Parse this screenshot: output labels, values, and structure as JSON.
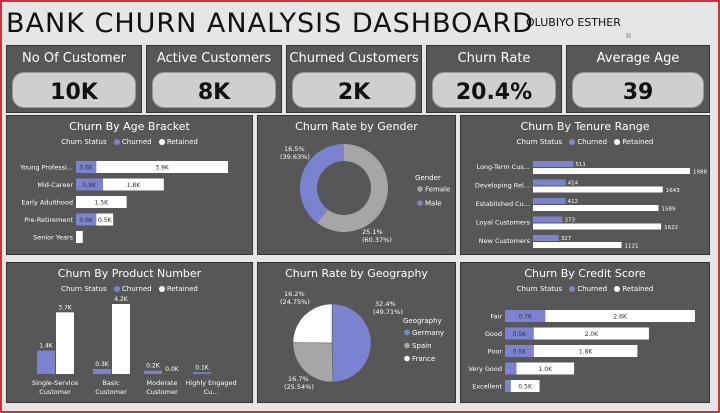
{
  "header": {
    "title": "BANK CHURN ANALYSIS DASHBOARD",
    "author": "OLUBIYO ESTHER"
  },
  "kpis": [
    {
      "label": "No Of Customer",
      "value": "10K"
    },
    {
      "label": "Active Customers",
      "value": "8K"
    },
    {
      "label": "Churned Customers",
      "value": "2K"
    },
    {
      "label": "Churn Rate",
      "value": "20.4%"
    },
    {
      "label": "Average Age",
      "value": "39"
    }
  ],
  "colors": {
    "churned": "#7b83d0",
    "retained": "#ffffff",
    "panel": "#575757",
    "spain": "#a6a6a6"
  },
  "legend": {
    "status_label": "Churn Status",
    "churned": "Churned",
    "retained": "Retained"
  },
  "chart_data": [
    {
      "id": "age",
      "type": "bar",
      "title": "Churn By Age Bracket",
      "orientation": "horizontal",
      "categories": [
        "Young Professi...",
        "Mid-Career",
        "Early Adulthood",
        "Pre-Retirement",
        "Senior Years"
      ],
      "series": [
        {
          "name": "Churned",
          "values": [
            0.6,
            0.8,
            0.0,
            0.6,
            0.0
          ],
          "labels": [
            "0.6K",
            "0.8K",
            "",
            "0.6K",
            ""
          ]
        },
        {
          "name": "Retained",
          "values": [
            3.9,
            1.8,
            1.5,
            0.5,
            0.2
          ],
          "labels": [
            "3.9K",
            "1.8K",
            "1.5K",
            "0.5K",
            ""
          ]
        }
      ]
    },
    {
      "id": "gender",
      "type": "pie",
      "title": "Churn Rate by Gender",
      "legend_title": "Gender",
      "slices": [
        {
          "name": "Female",
          "value": 25.1,
          "label": "25.1%",
          "sublabel": "(60.37%)"
        },
        {
          "name": "Male",
          "value": 16.5,
          "label": "16.5%",
          "sublabel": "(39.63%)"
        }
      ]
    },
    {
      "id": "tenure",
      "type": "bar",
      "title": "Churn By Tenure Range",
      "orientation": "horizontal",
      "categories": [
        "Long-Term Cus...",
        "Developing Rel...",
        "Established Cu...",
        "Loyal Customers",
        "New Customers"
      ],
      "series": [
        {
          "name": "Churned",
          "values": [
            511,
            414,
            412,
            373,
            327
          ],
          "labels": [
            "511",
            "414",
            "412",
            "373",
            "327"
          ]
        },
        {
          "name": "Retained",
          "values": [
            1988,
            1643,
            1589,
            1622,
            1121
          ],
          "labels": [
            "1988",
            "1643",
            "1589",
            "1622",
            "1121"
          ]
        }
      ]
    },
    {
      "id": "product",
      "type": "bar",
      "title": "Churn By Product Number",
      "orientation": "vertical",
      "categories": [
        "Single-Service Customer",
        "Basic Customer",
        "Moderate Customer",
        "Highly Engaged Cu..."
      ],
      "series": [
        {
          "name": "Churned",
          "values": [
            1.4,
            0.3,
            0.2,
            0.1
          ],
          "labels": [
            "1.4K",
            "0.3K",
            "0.2K",
            "0.1K"
          ]
        },
        {
          "name": "Retained",
          "values": [
            3.7,
            4.2,
            0.0,
            0.0
          ],
          "labels": [
            "3.7K",
            "4.2K",
            "0.0K",
            ""
          ]
        }
      ]
    },
    {
      "id": "geography",
      "type": "pie",
      "title": "Churn Rate by Geography",
      "legend_title": "Geography",
      "slices": [
        {
          "name": "Germany",
          "value": 32.4,
          "label": "32.4%",
          "sublabel": "(49.71%)"
        },
        {
          "name": "Spain",
          "value": 16.7,
          "label": "16.7%",
          "sublabel": "(25.54%)"
        },
        {
          "name": "France",
          "value": 16.2,
          "label": "16.2%",
          "sublabel": "(24.75%)"
        }
      ]
    },
    {
      "id": "credit",
      "type": "bar",
      "title": "Churn By Credit Score",
      "orientation": "horizontal",
      "categories": [
        "Fair",
        "Good",
        "Poor",
        "Very Good",
        "Excellent"
      ],
      "series": [
        {
          "name": "Churned",
          "values": [
            0.7,
            0.5,
            0.5,
            0.2,
            0.1
          ],
          "labels": [
            "0.7K",
            "0.5K",
            "0.5K",
            "",
            ""
          ]
        },
        {
          "name": "Retained",
          "values": [
            2.6,
            2.0,
            1.8,
            1.0,
            0.5
          ],
          "labels": [
            "2.6K",
            "2.0K",
            "1.8K",
            "1.0K",
            "0.5K"
          ]
        }
      ]
    }
  ]
}
